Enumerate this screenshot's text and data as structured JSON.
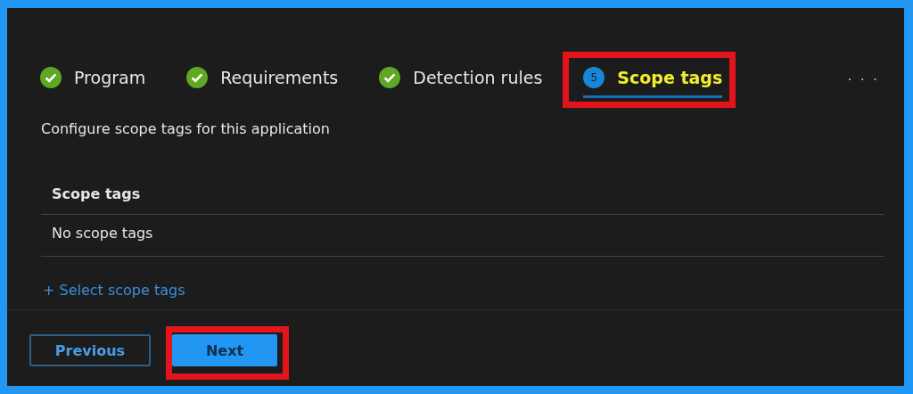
{
  "steps": [
    {
      "label": "Program",
      "kind": "done",
      "selected": false,
      "highlighted": false
    },
    {
      "label": "Requirements",
      "kind": "done",
      "selected": false,
      "highlighted": false
    },
    {
      "label": "Detection rules",
      "kind": "done",
      "selected": false,
      "highlighted": false
    },
    {
      "label": "Scope tags",
      "kind": "current",
      "number": "5",
      "selected": true,
      "highlighted": true
    }
  ],
  "more": "· · ·",
  "description": "Configure scope tags for this application",
  "table": {
    "columns": [
      "Scope tags"
    ],
    "rows": [
      [
        "No scope tags"
      ]
    ]
  },
  "add_link": "+ Select scope tags",
  "buttons": [
    {
      "label": "Previous",
      "kind": "secondary",
      "highlighted": false
    },
    {
      "label": "Next",
      "kind": "primary",
      "highlighted": true
    }
  ]
}
